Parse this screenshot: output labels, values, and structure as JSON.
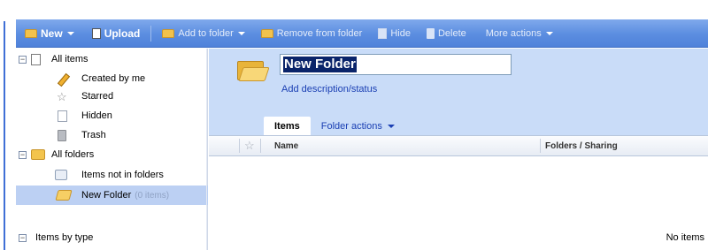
{
  "toolbar": {
    "new_label": "New",
    "upload_label": "Upload",
    "add_to_folder_label": "Add to folder",
    "remove_from_folder_label": "Remove from folder",
    "hide_label": "Hide",
    "delete_label": "Delete",
    "more_actions_label": "More actions"
  },
  "sidebar": {
    "items": [
      {
        "label": "All items",
        "icon": "document-icon",
        "toggle": "⊟"
      },
      {
        "label": "Created by me",
        "icon": "pencil-icon"
      },
      {
        "label": "Starred",
        "icon": "star-icon"
      },
      {
        "label": "Hidden",
        "icon": "page-icon"
      },
      {
        "label": "Trash",
        "icon": "trash-icon"
      },
      {
        "label": "All folders",
        "icon": "folder-icon",
        "toggle": "⊟"
      },
      {
        "label": "Items not in folders",
        "icon": "loose-items-icon"
      },
      {
        "label": "New Folder",
        "count": "(0 items)",
        "icon": "open-folder-icon",
        "selected": true
      },
      {
        "label": "Items by type",
        "toggle": "⊟"
      }
    ]
  },
  "main": {
    "folder_title": "New Folder",
    "description_link": "Add description/status",
    "tabs": [
      {
        "label": "Items",
        "active": true
      },
      {
        "label": "Folder actions"
      }
    ],
    "columns": {
      "name": "Name",
      "folders_sharing": "Folders / Sharing"
    },
    "empty_message": "No items"
  },
  "colors": {
    "toolbar_blue": "#5b8de0",
    "header_blue": "#c9dcf8",
    "selected_row": "#bcd0f3",
    "link_blue": "#1a3fb3"
  }
}
